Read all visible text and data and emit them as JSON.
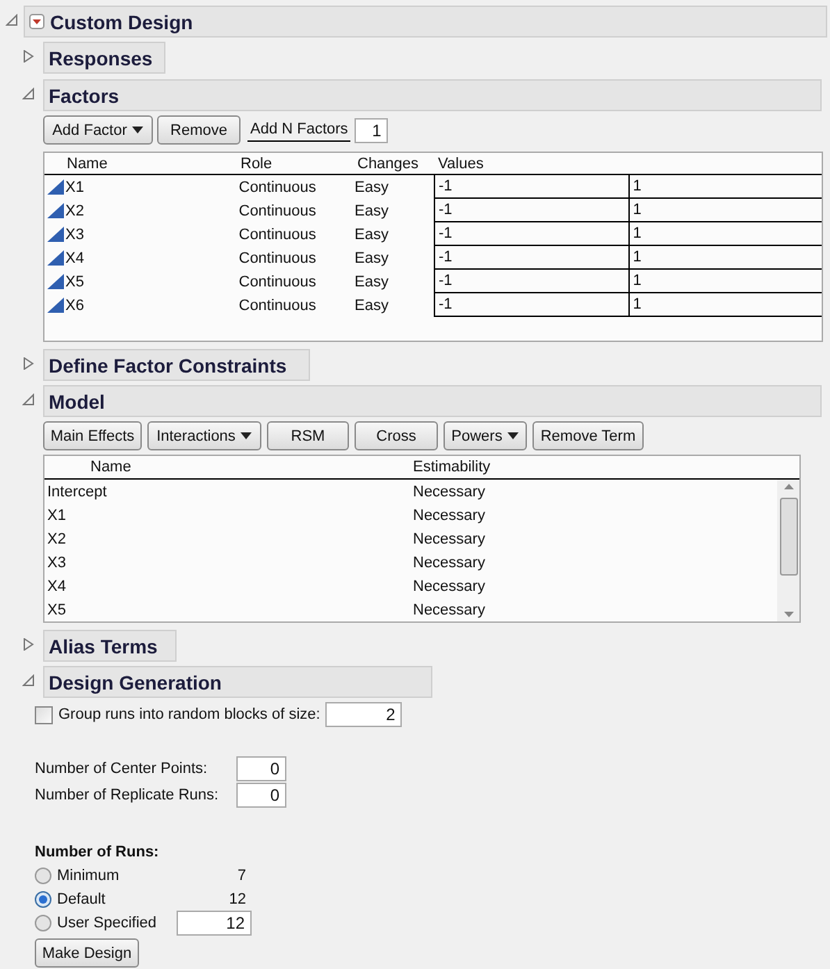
{
  "title": "Custom Design",
  "expanded": true,
  "responses": {
    "title": "Responses",
    "expanded": false
  },
  "factors": {
    "title": "Factors",
    "expanded": true,
    "buttons": [
      {
        "label": "Add Factor",
        "dropdown": true
      },
      {
        "label": "Remove",
        "dropdown": false
      }
    ],
    "add_n_label": "Add N Factors",
    "add_n_value": "1",
    "columns": [
      "Name",
      "Role",
      "Changes",
      "Values"
    ],
    "rows": [
      {
        "name": "X1",
        "role": "Continuous",
        "changes": "Easy",
        "low": "-1",
        "high": "1"
      },
      {
        "name": "X2",
        "role": "Continuous",
        "changes": "Easy",
        "low": "-1",
        "high": "1"
      },
      {
        "name": "X3",
        "role": "Continuous",
        "changes": "Easy",
        "low": "-1",
        "high": "1"
      },
      {
        "name": "X4",
        "role": "Continuous",
        "changes": "Easy",
        "low": "-1",
        "high": "1"
      },
      {
        "name": "X5",
        "role": "Continuous",
        "changes": "Easy",
        "low": "-1",
        "high": "1"
      },
      {
        "name": "X6",
        "role": "Continuous",
        "changes": "Easy",
        "low": "-1",
        "high": "1"
      }
    ]
  },
  "constraints": {
    "title": "Define Factor Constraints",
    "expanded": false
  },
  "model": {
    "title": "Model",
    "expanded": true,
    "buttons": [
      {
        "label": "Main Effects",
        "dropdown": false
      },
      {
        "label": "Interactions",
        "dropdown": true
      },
      {
        "label": "RSM",
        "dropdown": false
      },
      {
        "label": "Cross",
        "dropdown": false
      },
      {
        "label": "Powers",
        "dropdown": true
      },
      {
        "label": "Remove Term",
        "dropdown": false
      }
    ],
    "columns": [
      "Name",
      "Estimability"
    ],
    "rows": [
      {
        "name": "Intercept",
        "estimability": "Necessary"
      },
      {
        "name": "X1",
        "estimability": "Necessary"
      },
      {
        "name": "X2",
        "estimability": "Necessary"
      },
      {
        "name": "X3",
        "estimability": "Necessary"
      },
      {
        "name": "X4",
        "estimability": "Necessary"
      },
      {
        "name": "X5",
        "estimability": "Necessary"
      }
    ]
  },
  "alias": {
    "title": "Alias Terms",
    "expanded": false
  },
  "generation": {
    "title": "Design Generation",
    "expanded": true,
    "blocks": {
      "label": "Group runs into random blocks of size:",
      "checked": false,
      "value": "2"
    },
    "center_points": {
      "label": "Number of Center Points:",
      "value": "0"
    },
    "replicates": {
      "label": "Number of Replicate Runs:",
      "value": "0"
    },
    "runs_label": "Number of Runs:",
    "runs": [
      {
        "kind": "fixed",
        "label": "Minimum",
        "value": "7",
        "selected": false
      },
      {
        "kind": "fixed",
        "label": "Default",
        "value": "12",
        "selected": true
      },
      {
        "kind": "input",
        "label": "User Specified",
        "value": "12",
        "selected": false
      }
    ],
    "make_button": "Make Design"
  }
}
